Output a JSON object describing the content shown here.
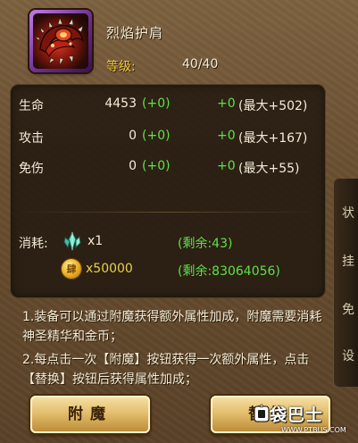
{
  "item": {
    "name": "烈焰护肩",
    "level_label": "等级:",
    "level_value": "40/40"
  },
  "stats": [
    {
      "name": "生命",
      "value": "4453",
      "bonus": "(+0)",
      "extra": "+0",
      "max": "(最大+502)"
    },
    {
      "name": "攻击",
      "value": "0",
      "bonus": "(+0)",
      "extra": "+0",
      "max": "(最大+167)"
    },
    {
      "name": "免伤",
      "value": "0",
      "bonus": "(+0)",
      "extra": "+0",
      "max": "(最大+55)"
    }
  ],
  "cost": {
    "label": "消耗:",
    "crystal_qty": "x1",
    "crystal_remaining": "(剩余:43)",
    "gold_qty": "x50000",
    "gold_remaining": "(剩余:83064056)",
    "coin_glyph": "肆"
  },
  "notes": [
    "1.装备可以通过附魔获得额外属性加成，附魔需要消耗神圣精华和金币；",
    "2.每点击一次【附魔】按钮获得一次额外属性，点击【替换】按钮后获得属性加成；"
  ],
  "buttons": {
    "enchant": "附魔",
    "replace": "替换"
  },
  "side_tabs": [
    "状",
    "挂",
    "免",
    "设"
  ],
  "watermark": {
    "text": "袋巴士",
    "url": "WWW.PTBUS.COM"
  },
  "colors": {
    "green": "#5fe04a",
    "gold_label": "#f0c640",
    "item_frame_purple": "#6c2d8f"
  },
  "icons": {
    "item": "shoulder-armor-icon",
    "crystal": "crystal-shard-icon",
    "coin": "gold-coin-icon"
  }
}
